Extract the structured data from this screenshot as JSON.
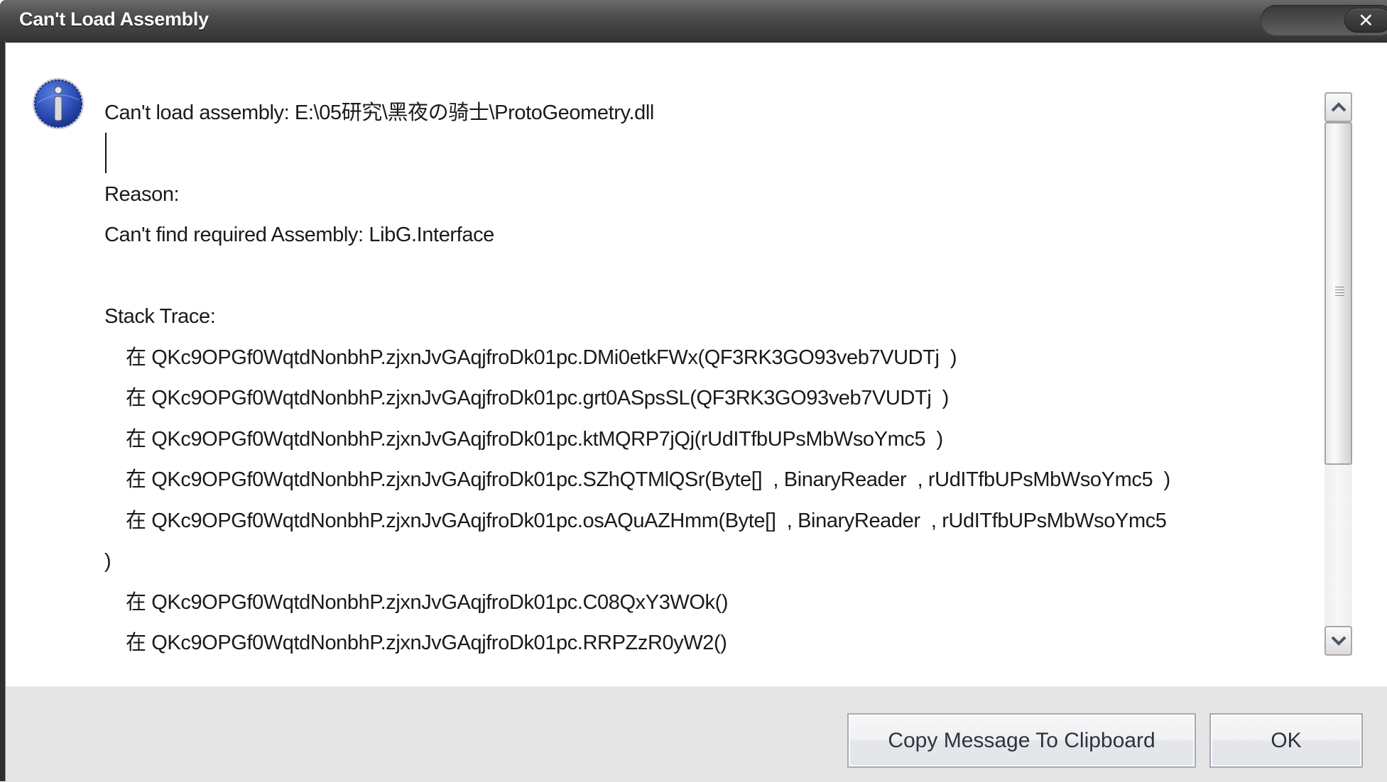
{
  "window": {
    "title": "Can't Load Assembly",
    "close_label": "✕",
    "close_icon": "close-icon"
  },
  "icon": {
    "semantic": "info-icon",
    "color": "#2a4fb5"
  },
  "message": {
    "header": "Can't load assembly: E:\\05研究\\黑夜の骑士\\ProtoGeometry.dll",
    "reason_label": "Reason:",
    "reason_text": "Can't find required Assembly: LibG.Interface",
    "stack_label": "Stack Trace:",
    "stack_lines": [
      "在 QKc9OPGf0WqtdNonbhP.zjxnJvGAqjfroDk01pc.DMi0etkFWx(QF3RK3GO93veb7VUDTj  )",
      "在 QKc9OPGf0WqtdNonbhP.zjxnJvGAqjfroDk01pc.grt0ASpsSL(QF3RK3GO93veb7VUDTj  )",
      "在 QKc9OPGf0WqtdNonbhP.zjxnJvGAqjfroDk01pc.ktMQRP7jQj(rUdITfbUPsMbWsoYmc5  )",
      "在 QKc9OPGf0WqtdNonbhP.zjxnJvGAqjfroDk01pc.SZhQTMlQSr(Byte[]  , BinaryReader  , rUdITfbUPsMbWsoYmc5  )",
      "在 QKc9OPGf0WqtdNonbhP.zjxnJvGAqjfroDk01pc.osAQuAZHmm(Byte[]  , BinaryReader  , rUdITfbUPsMbWsoYmc5"
    ],
    "wrap_line": ")",
    "stack_lines_after": [
      "在 QKc9OPGf0WqtdNonbhP.zjxnJvGAqjfroDk01pc.C08QxY3WOk()",
      "在 QKc9OPGf0WqtdNonbhP.zjxnJvGAqjfroDk01pc.RRPZzR0yW2()"
    ]
  },
  "scrollbar": {
    "up_label": "⌃",
    "down_label": "⌄",
    "position_fraction": 0.0,
    "visible_fraction": 0.68
  },
  "buttons": {
    "copy_label": "Copy Message To Clipboard",
    "ok_label": "OK"
  }
}
